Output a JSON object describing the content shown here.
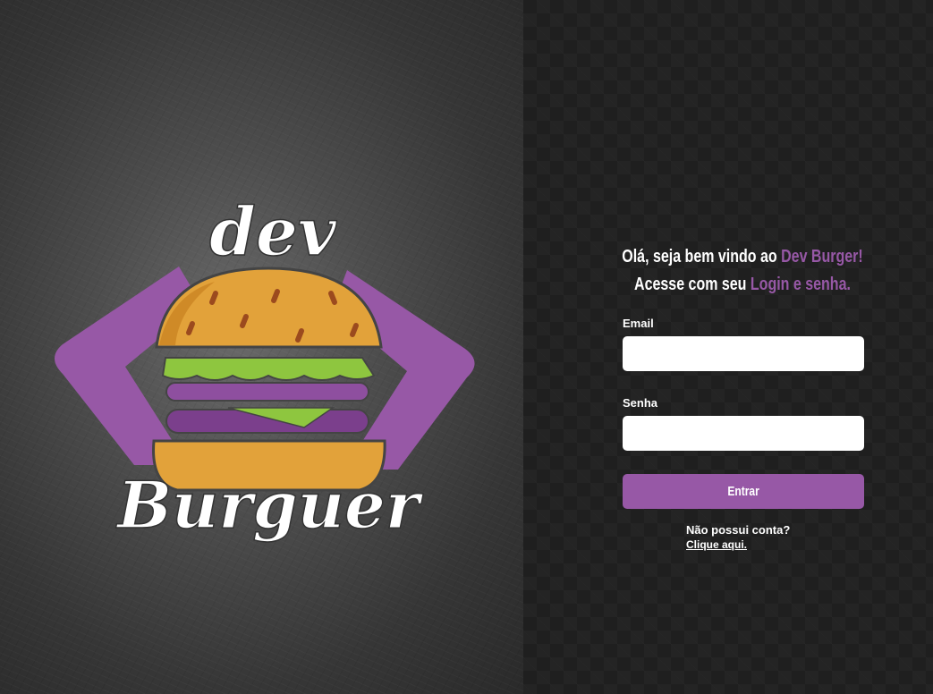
{
  "logo": {
    "word_top": "dev",
    "word_bottom": "Burguer"
  },
  "colors": {
    "accent": "#9758a6",
    "bun": "#e2a23a",
    "bun_shadow": "#cf8a27",
    "lettuce": "#8ec63f",
    "sesame": "#9b4a1e",
    "panel_dark": "#1f1f1f",
    "input_bg": "#ffffff"
  },
  "welcome": {
    "line1_prefix": "Olá, seja bem vindo ao ",
    "line1_accent": "Dev Burger!",
    "line2_prefix": "Acesse com seu ",
    "line2_accent": "Login e senha."
  },
  "form": {
    "email_label": "Email",
    "email_value": "",
    "password_label": "Senha",
    "password_value": "",
    "submit_label": "Entrar"
  },
  "signup": {
    "question": "Não possui conta?",
    "link": "Clique aqui."
  }
}
